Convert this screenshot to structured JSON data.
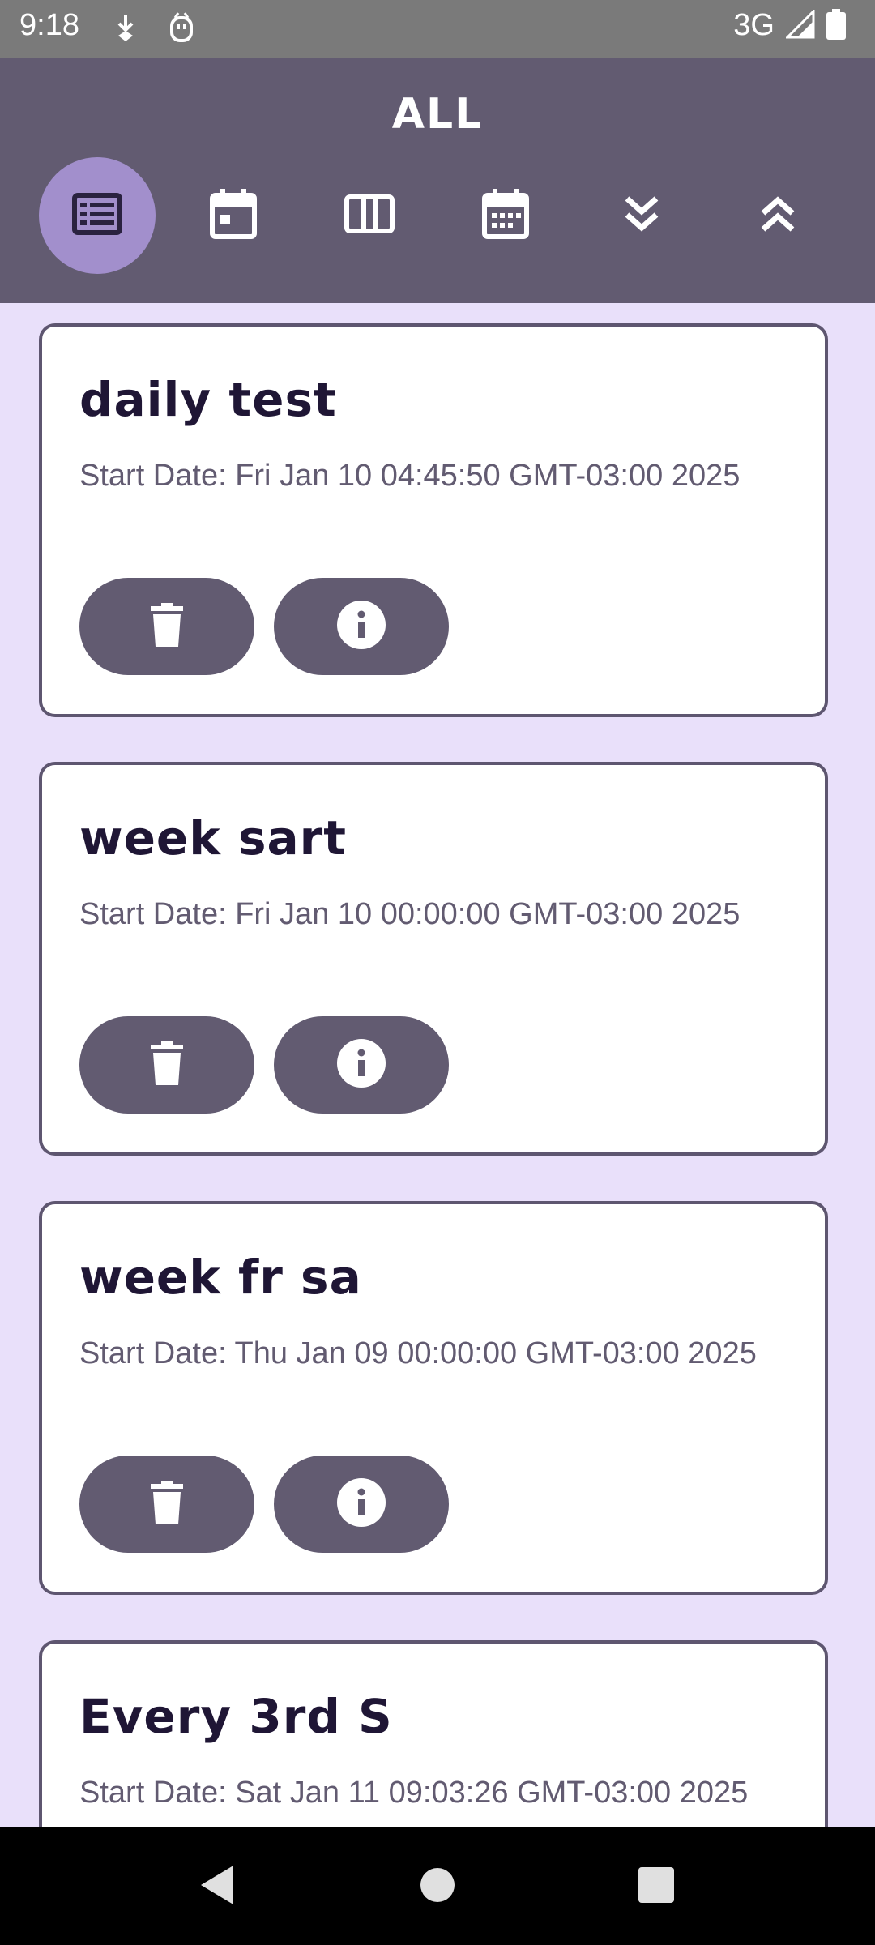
{
  "status_bar": {
    "time": "9:18",
    "network": "3G"
  },
  "header": {
    "title": "ALL"
  },
  "toolbar": {
    "buttons": [
      {
        "icon": "list-view-icon",
        "active": true
      },
      {
        "icon": "day-calendar-icon",
        "active": false
      },
      {
        "icon": "week-columns-icon",
        "active": false
      },
      {
        "icon": "month-calendar-icon",
        "active": false
      },
      {
        "icon": "expand-all-icon",
        "active": false
      },
      {
        "icon": "collapse-all-icon",
        "active": false
      }
    ]
  },
  "items": [
    {
      "title": "daily test",
      "start_date": "Start Date: Fri Jan 10 04:45:50 GMT-03:00 2025"
    },
    {
      "title": "week sart",
      "start_date": "Start Date: Fri Jan 10 00:00:00 GMT-03:00 2025"
    },
    {
      "title": "week fr sa",
      "start_date": "Start Date: Thu Jan 09 00:00:00 GMT-03:00 2025"
    },
    {
      "title": "Every 3rd S",
      "start_date": "Start Date: Sat Jan 11 09:03:26 GMT-03:00 2025"
    }
  ],
  "colors": {
    "header_bg": "#625B71",
    "active_button_bg": "#A28FCC",
    "list_bg": "#E9E0FA",
    "card_border": "#5E5670",
    "title_text": "#1F1635"
  }
}
